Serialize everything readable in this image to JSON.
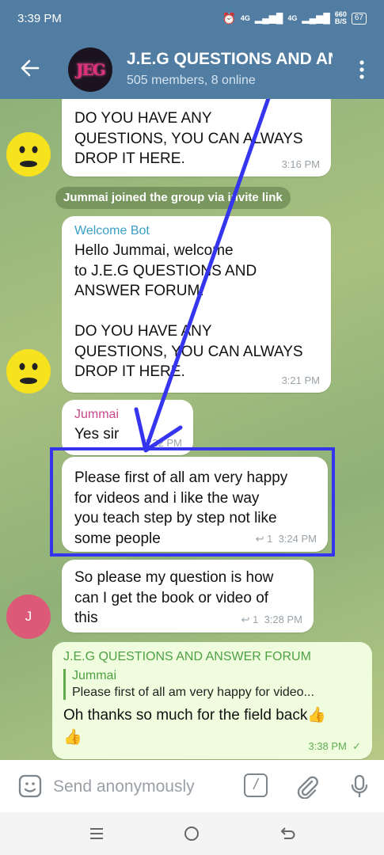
{
  "status": {
    "time": "3:39 PM",
    "net1": "4G",
    "net2": "4G",
    "speed": "660",
    "speed_unit": "B/S",
    "battery": "67"
  },
  "header": {
    "title": "J.E.G QUESTIONS AND ANSWER FORUM",
    "subtitle": "505 members, 8 online",
    "avatar_text": "JEG"
  },
  "messages": [
    {
      "text": "DO YOU HAVE ANY\nQUESTIONS, YOU CAN ALWAYS\nDROP IT HERE.",
      "time": "3:16 PM"
    },
    {
      "service": "Jummai joined the group via invite link"
    },
    {
      "sender": "Welcome Bot",
      "text": "Hello Jummai, welcome\nto J.E.G QUESTIONS AND\nANSWER FORUM!\n\nDO YOU HAVE ANY\nQUESTIONS, YOU CAN ALWAYS\nDROP IT HERE.",
      "time": "3:21 PM"
    },
    {
      "sender": "Jummai",
      "text": "Yes sir",
      "time": "3:22 PM"
    },
    {
      "text": "Please first of all am very happy\nfor videos and i like the way\nyou teach step by step not like\nsome people",
      "replies": "1",
      "time": "3:24 PM"
    },
    {
      "text": "So please my question is how\ncan I get the book or video of\nthis",
      "replies": "1",
      "time": "3:28 PM",
      "avatar": "J"
    },
    {
      "sender": "J.E.G QUESTIONS AND ANSWER FORUM",
      "quote_name": "Jummai",
      "quote_text": "Please first of all am very happy for video...",
      "text": "Oh thanks so much for the field back👍\n👍",
      "time": "3:38 PM",
      "status": "✓"
    }
  ],
  "input": {
    "placeholder": "Send anonymously",
    "command_label": "/"
  },
  "colors": {
    "header": "#517da2",
    "highlight": "#3535f0",
    "outgoing": "#effdde"
  }
}
